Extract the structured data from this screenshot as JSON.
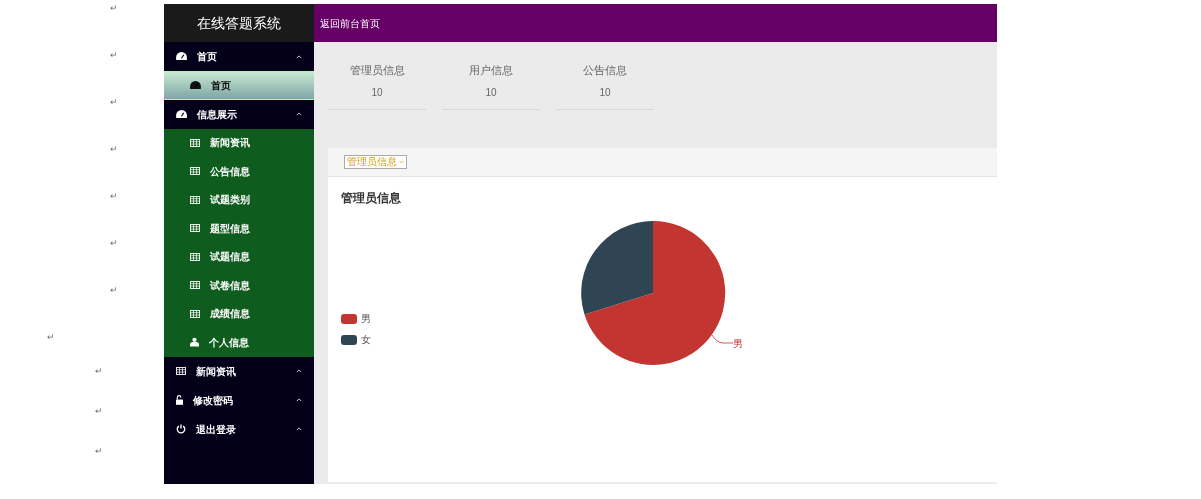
{
  "paragraph_marks": [
    "↵",
    "↵",
    "↵",
    "↵",
    "↵",
    "↵",
    "↵",
    "↵",
    "↵",
    "↵",
    "↵"
  ],
  "sidebar": {
    "title": "在线答题系统",
    "items": [
      {
        "label": "首页",
        "kind": "dashboard",
        "children": [
          {
            "label": "首页",
            "kind": "dashboard",
            "selected": true
          }
        ]
      },
      {
        "label": "信息展示",
        "kind": "dashboard",
        "children": [
          {
            "label": "新闻资讯",
            "kind": "table",
            "selected": false
          },
          {
            "label": "公告信息",
            "kind": "table",
            "selected": false
          },
          {
            "label": "试题类别",
            "kind": "table",
            "selected": false
          },
          {
            "label": "题型信息",
            "kind": "table",
            "selected": false
          },
          {
            "label": "试题信息",
            "kind": "table",
            "selected": false
          },
          {
            "label": "试卷信息",
            "kind": "table",
            "selected": false
          },
          {
            "label": "成绩信息",
            "kind": "table",
            "selected": false
          },
          {
            "label": "个人信息",
            "kind": "user",
            "selected": false
          }
        ]
      },
      {
        "label": "新闻资讯",
        "kind": "table"
      },
      {
        "label": "修改密码",
        "kind": "lock"
      },
      {
        "label": "退出登录",
        "kind": "power"
      }
    ]
  },
  "top_bar": {
    "link": "返回前台首页"
  },
  "stats": [
    {
      "label": "管理员信息",
      "value": "10"
    },
    {
      "label": "用户信息",
      "value": "10"
    },
    {
      "label": "公告信息",
      "value": "10"
    }
  ],
  "chart_panel": {
    "select": "管理员信息",
    "title": "管理员信息",
    "legend": [
      {
        "label": "男",
        "color": "#c23531"
      },
      {
        "label": "女",
        "color": "#2f4554"
      }
    ],
    "slice_label": "男"
  }
}
